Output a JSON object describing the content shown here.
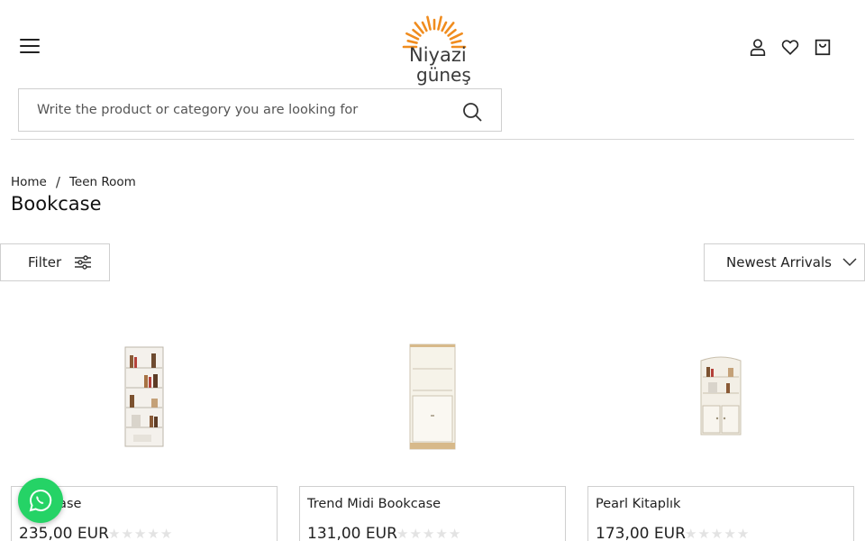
{
  "header": {
    "logo_text_top": "Niyazi",
    "logo_text_bottom": "güneş"
  },
  "search": {
    "placeholder": "Write the product or category you are looking for"
  },
  "breadcrumb": {
    "items": [
      "Home",
      "Teen Room"
    ]
  },
  "page": {
    "title": "Bookcase"
  },
  "toolbar": {
    "filter_label": "Filter",
    "sort_label": "Newest Arrivals"
  },
  "products": [
    {
      "name": "Bookcase",
      "price": "235,00 EUR",
      "rating": 0,
      "stars_max": 5
    },
    {
      "name": "Trend Midi Bookcase",
      "price": "131,00 EUR",
      "rating": 0,
      "stars_max": 5
    },
    {
      "name": "Pearl Kitaplık",
      "price": "173,00 EUR",
      "rating": 0,
      "stars_max": 5
    }
  ],
  "colors": {
    "brand_orange": "#f08c1e",
    "brand_dark": "#3a3a3a",
    "whatsapp_green": "#25d366",
    "star_empty": "#e3e3e3"
  },
  "icons": {
    "menu": "hamburger-icon",
    "account": "user-icon",
    "wishlist": "heart-icon",
    "cart": "shopping-bag-icon",
    "search": "search-icon",
    "filter": "sliders-icon",
    "sort": "chevron-down-icon",
    "chat": "whatsapp-icon"
  }
}
